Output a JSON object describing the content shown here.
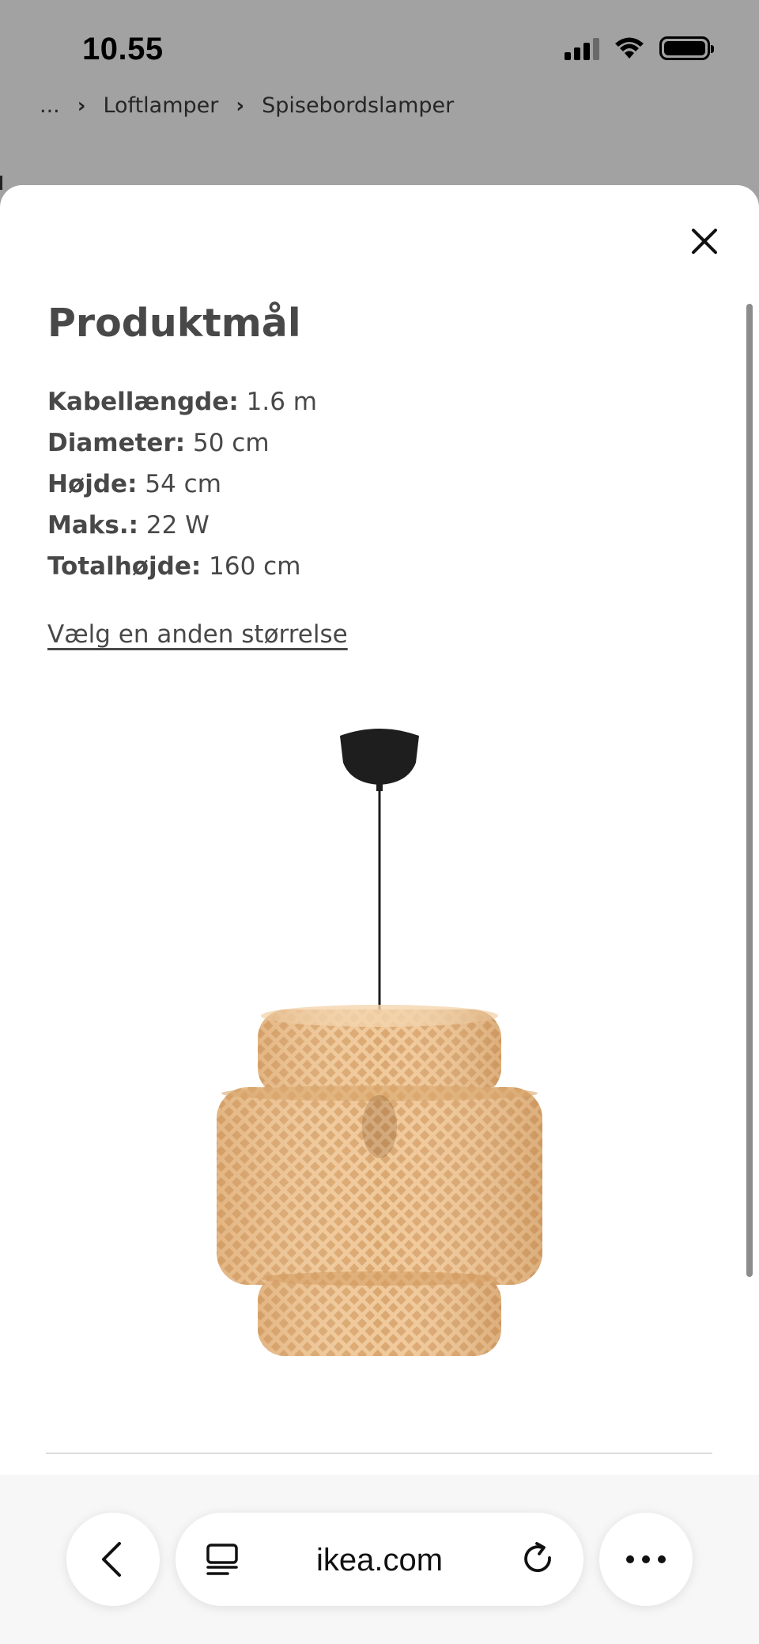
{
  "status_bar": {
    "time": "10.55",
    "icons": [
      "cellular-signal-icon",
      "wifi-icon",
      "battery-icon"
    ]
  },
  "breadcrumb": {
    "ellipsis": "...",
    "items": [
      "Loftlamper",
      "Spisebordslamper"
    ]
  },
  "sheet": {
    "title": "Produktmål",
    "specs": [
      {
        "label": "Kabellængde:",
        "value": "1.6 m"
      },
      {
        "label": "Diameter:",
        "value": "50 cm"
      },
      {
        "label": "Højde:",
        "value": "54 cm"
      },
      {
        "label": "Maks.:",
        "value": "22 W"
      },
      {
        "label": "Totalhøjde:",
        "value": "160 cm"
      }
    ],
    "size_link": "Vælg en anden størrelse",
    "close_icon": "close-icon",
    "colors": {
      "text": "#484848",
      "shade": "#e7b987",
      "canopy": "#1e1e1e"
    }
  },
  "browser": {
    "url": "ikea.com",
    "icons": [
      "back-icon",
      "tabs-icon",
      "reload-icon",
      "more-icon"
    ]
  }
}
